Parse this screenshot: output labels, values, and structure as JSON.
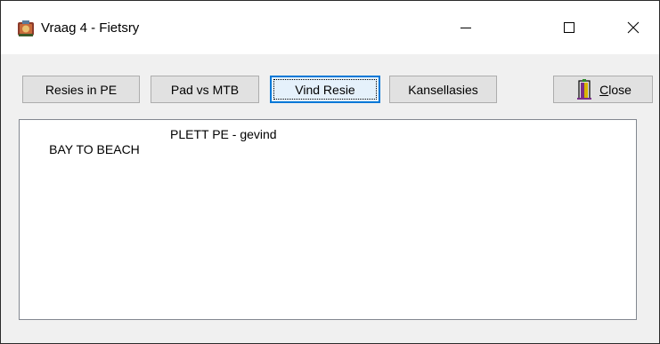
{
  "window": {
    "title": "Vraag 4 - Fietsry",
    "app_icon": "delphi-app-icon",
    "caption_buttons": {
      "minimize_icon": "minimize-icon",
      "maximize_icon": "maximize-icon",
      "close_icon": "close-icon"
    }
  },
  "toolbar": {
    "buttons": [
      {
        "label": "Resies in PE"
      },
      {
        "label": "Pad vs MTB"
      },
      {
        "label": "Vind Resie",
        "state": "focused-default"
      },
      {
        "label": "Kansellasies"
      },
      {
        "label": "Close",
        "icon": "door-exit-icon",
        "accelerator": "C"
      }
    ]
  },
  "memo": {
    "lines": [
      {
        "col1": "BAY TO BEACH",
        "col2": "PLETT PE - gevind"
      }
    ]
  },
  "colors": {
    "window_bg": "#f0f0f0",
    "titlebar_bg": "#ffffff",
    "button_bg": "#e1e1e1",
    "button_border": "#adadad",
    "focus_accent": "#0078d7",
    "memo_bg": "#ffffff"
  }
}
